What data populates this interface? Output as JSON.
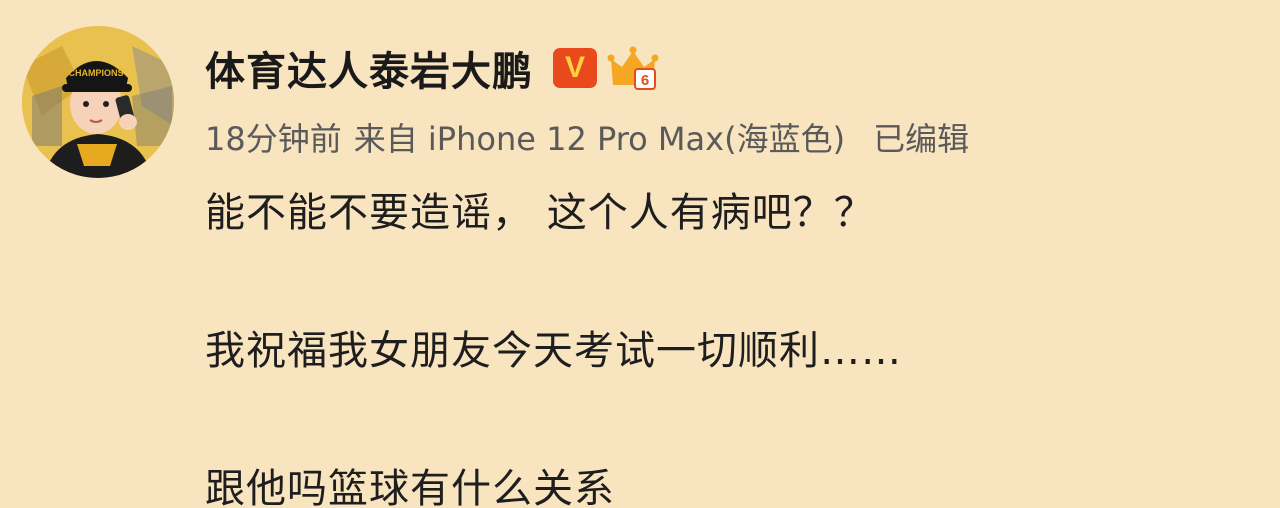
{
  "post": {
    "username": "体育达人泰岩大鹏",
    "verified_badge": "V",
    "meta": {
      "time": "18分钟前",
      "source": "来自 iPhone 12 Pro Max(海蓝色)",
      "edited": "已编辑"
    },
    "content": {
      "line1": "能不能不要造谣， 这个人有病吧？？",
      "line2": "我祝福我女朋友今天考试一切顺利……",
      "line3": "跟他吗篮球有什么关系"
    },
    "icons": {
      "avatar": "user-avatar",
      "verified": "verified-v-icon",
      "vip": "crown-level-icon"
    },
    "colors": {
      "background": "#f9e4c0",
      "verified_badge": "#e8491d",
      "crown": "#f5a623"
    }
  }
}
